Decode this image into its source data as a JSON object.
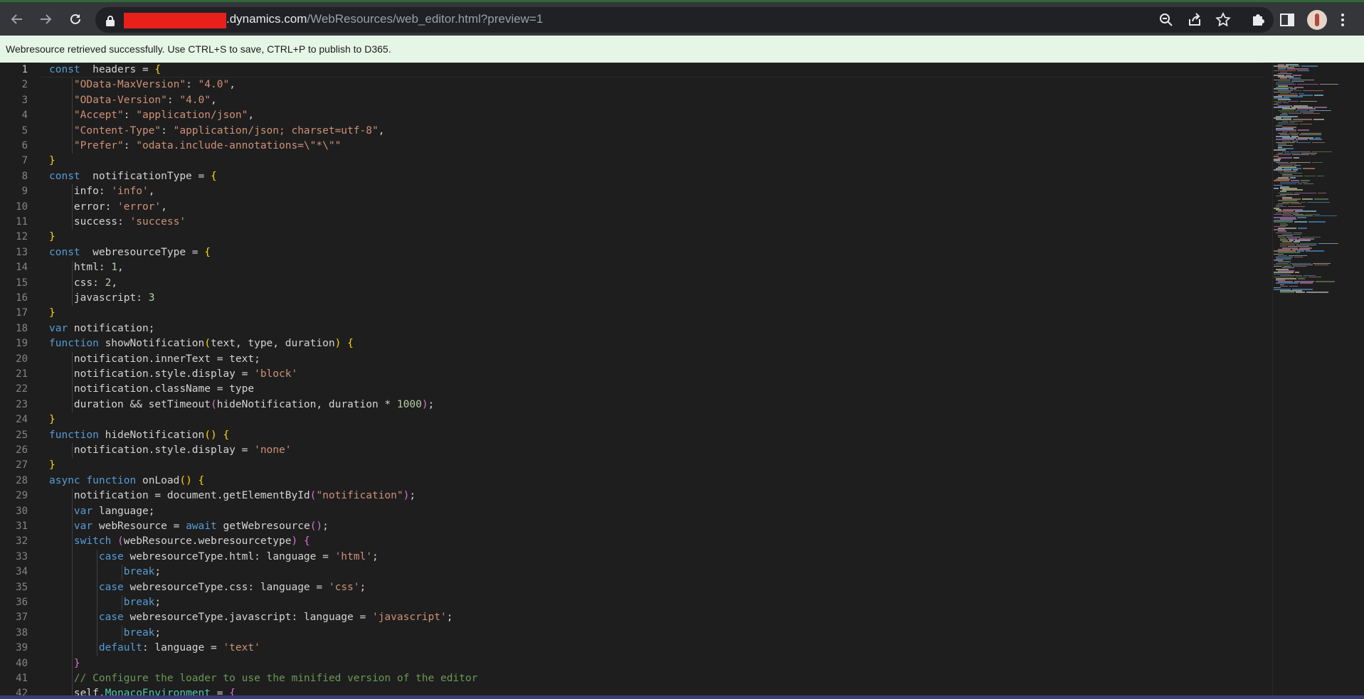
{
  "browser": {
    "url_domain": ".dynamics.com",
    "url_path": "/WebResources/web_editor.html?preview=1",
    "icons": [
      "back-icon",
      "forward-icon",
      "reload-icon",
      "lock-icon",
      "zoom-icon",
      "share-icon",
      "bookmark-star-icon",
      "extensions-icon",
      "side-panel-icon",
      "profile-avatar",
      "menu-kebab-icon"
    ]
  },
  "notification": {
    "text": "Webresource retrieved successfully. Use CTRL+S to save, CTRL+P to publish to D365."
  },
  "editor": {
    "active_line": 1,
    "line_numbers": [
      "1",
      "2",
      "3",
      "4",
      "5",
      "6",
      "7",
      "8",
      "9",
      "10",
      "11",
      "12",
      "13",
      "14",
      "15",
      "16",
      "17",
      "18",
      "19",
      "20",
      "21",
      "22",
      "23",
      "24",
      "25",
      "26",
      "27",
      "28",
      "29",
      "30",
      "31",
      "32",
      "33",
      "34",
      "35",
      "36",
      "37",
      "38",
      "39",
      "40",
      "41",
      "42"
    ],
    "lines": [
      [
        [
          "kw",
          "const"
        ],
        [
          "",
          "  headers = "
        ],
        [
          "b1",
          "{"
        ]
      ],
      [
        [
          "",
          "    "
        ],
        [
          "str",
          "\"OData-MaxVersion\""
        ],
        [
          "",
          ": "
        ],
        [
          "str",
          "\"4.0\""
        ],
        [
          "",
          ","
        ]
      ],
      [
        [
          "",
          "    "
        ],
        [
          "str",
          "\"OData-Version\""
        ],
        [
          "",
          ": "
        ],
        [
          "str",
          "\"4.0\""
        ],
        [
          "",
          ","
        ]
      ],
      [
        [
          "",
          "    "
        ],
        [
          "str",
          "\"Accept\""
        ],
        [
          "",
          ": "
        ],
        [
          "str",
          "\"application/json\""
        ],
        [
          "",
          ","
        ]
      ],
      [
        [
          "",
          "    "
        ],
        [
          "str",
          "\"Content-Type\""
        ],
        [
          "",
          ": "
        ],
        [
          "str",
          "\"application/json; charset=utf-8\""
        ],
        [
          "",
          ","
        ]
      ],
      [
        [
          "",
          "    "
        ],
        [
          "str",
          "\"Prefer\""
        ],
        [
          "",
          ": "
        ],
        [
          "str",
          "\"odata.include-annotations=\\\"*\\\"\""
        ]
      ],
      [
        [
          "b1",
          "}"
        ]
      ],
      [
        [
          "kw",
          "const"
        ],
        [
          "",
          "  notificationType = "
        ],
        [
          "b1",
          "{"
        ]
      ],
      [
        [
          "",
          "    info: "
        ],
        [
          "str",
          "'info'"
        ],
        [
          "",
          ","
        ]
      ],
      [
        [
          "",
          "    error: "
        ],
        [
          "str",
          "'error'"
        ],
        [
          "",
          ","
        ]
      ],
      [
        [
          "",
          "    success: "
        ],
        [
          "str",
          "'success'"
        ]
      ],
      [
        [
          "b1",
          "}"
        ]
      ],
      [
        [
          "kw",
          "const"
        ],
        [
          "",
          "  webresourceType = "
        ],
        [
          "b1",
          "{"
        ]
      ],
      [
        [
          "",
          "    html: "
        ],
        [
          "num",
          "1"
        ],
        [
          "",
          ","
        ]
      ],
      [
        [
          "",
          "    css: "
        ],
        [
          "num",
          "2"
        ],
        [
          "",
          ","
        ]
      ],
      [
        [
          "",
          "    javascript: "
        ],
        [
          "num",
          "3"
        ]
      ],
      [
        [
          "b1",
          "}"
        ]
      ],
      [
        [
          "kw",
          "var"
        ],
        [
          "",
          " notification;"
        ]
      ],
      [
        [
          "kw",
          "function"
        ],
        [
          "",
          " showNotification"
        ],
        [
          "b1",
          "("
        ],
        [
          "",
          "text, type, duration"
        ],
        [
          "b1",
          ")"
        ],
        [
          "",
          " "
        ],
        [
          "b1",
          "{"
        ]
      ],
      [
        [
          "",
          "    notification.innerText = text;"
        ]
      ],
      [
        [
          "",
          "    notification.style.display = "
        ],
        [
          "str",
          "'block'"
        ]
      ],
      [
        [
          "",
          "    notification.className = type"
        ]
      ],
      [
        [
          "",
          "    duration && setTimeout"
        ],
        [
          "b2",
          "("
        ],
        [
          "",
          "hideNotification, duration * "
        ],
        [
          "num",
          "1000"
        ],
        [
          "b2",
          ")"
        ],
        [
          "",
          ";"
        ]
      ],
      [
        [
          "b1",
          "}"
        ]
      ],
      [
        [
          "kw",
          "function"
        ],
        [
          "",
          " hideNotification"
        ],
        [
          "b1",
          "()"
        ],
        [
          "",
          " "
        ],
        [
          "b1",
          "{"
        ]
      ],
      [
        [
          "",
          "    notification.style.display = "
        ],
        [
          "str",
          "'none'"
        ]
      ],
      [
        [
          "b1",
          "}"
        ]
      ],
      [
        [
          "kw",
          "async"
        ],
        [
          "",
          " "
        ],
        [
          "kw",
          "function"
        ],
        [
          "",
          " onLoad"
        ],
        [
          "b1",
          "()"
        ],
        [
          "",
          " "
        ],
        [
          "b1",
          "{"
        ]
      ],
      [
        [
          "",
          "    notification = document.getElementById"
        ],
        [
          "b2",
          "("
        ],
        [
          "str",
          "\"notification\""
        ],
        [
          "b2",
          ")"
        ],
        [
          "",
          ";"
        ]
      ],
      [
        [
          "",
          "    "
        ],
        [
          "kw",
          "var"
        ],
        [
          "",
          " language;"
        ]
      ],
      [
        [
          "",
          "    "
        ],
        [
          "kw",
          "var"
        ],
        [
          "",
          " webResource = "
        ],
        [
          "kw",
          "await"
        ],
        [
          "",
          " getWebresource"
        ],
        [
          "b2",
          "()"
        ],
        [
          "",
          ";"
        ]
      ],
      [
        [
          "",
          "    "
        ],
        [
          "kw",
          "switch"
        ],
        [
          "",
          " "
        ],
        [
          "b2",
          "("
        ],
        [
          "",
          "webResource.webresourcetype"
        ],
        [
          "b2",
          ")"
        ],
        [
          "",
          " "
        ],
        [
          "b2",
          "{"
        ]
      ],
      [
        [
          "",
          "        "
        ],
        [
          "kw",
          "case"
        ],
        [
          "",
          " webresourceType.html: language = "
        ],
        [
          "str",
          "'html'"
        ],
        [
          "",
          ";"
        ]
      ],
      [
        [
          "",
          "            "
        ],
        [
          "kw",
          "break"
        ],
        [
          "",
          ";"
        ]
      ],
      [
        [
          "",
          "        "
        ],
        [
          "kw",
          "case"
        ],
        [
          "",
          " webresourceType.css: language = "
        ],
        [
          "str",
          "'css'"
        ],
        [
          "",
          ";"
        ]
      ],
      [
        [
          "",
          "            "
        ],
        [
          "kw",
          "break"
        ],
        [
          "",
          ";"
        ]
      ],
      [
        [
          "",
          "        "
        ],
        [
          "kw",
          "case"
        ],
        [
          "",
          " webresourceType.javascript: language = "
        ],
        [
          "str",
          "'javascript'"
        ],
        [
          "",
          ";"
        ]
      ],
      [
        [
          "",
          "            "
        ],
        [
          "kw",
          "break"
        ],
        [
          "",
          ";"
        ]
      ],
      [
        [
          "",
          "        "
        ],
        [
          "kw",
          "default"
        ],
        [
          "",
          ": language = "
        ],
        [
          "str",
          "'text'"
        ]
      ],
      [
        [
          "",
          "    "
        ],
        [
          "b2",
          "}"
        ]
      ],
      [
        [
          "",
          "    "
        ],
        [
          "cm",
          "// Configure the loader to use the minified version of the editor"
        ]
      ],
      [
        [
          "",
          "    self."
        ],
        [
          "ty",
          "MonacoEnvironment"
        ],
        [
          "",
          " = "
        ],
        [
          "b2",
          "{"
        ]
      ]
    ]
  }
}
